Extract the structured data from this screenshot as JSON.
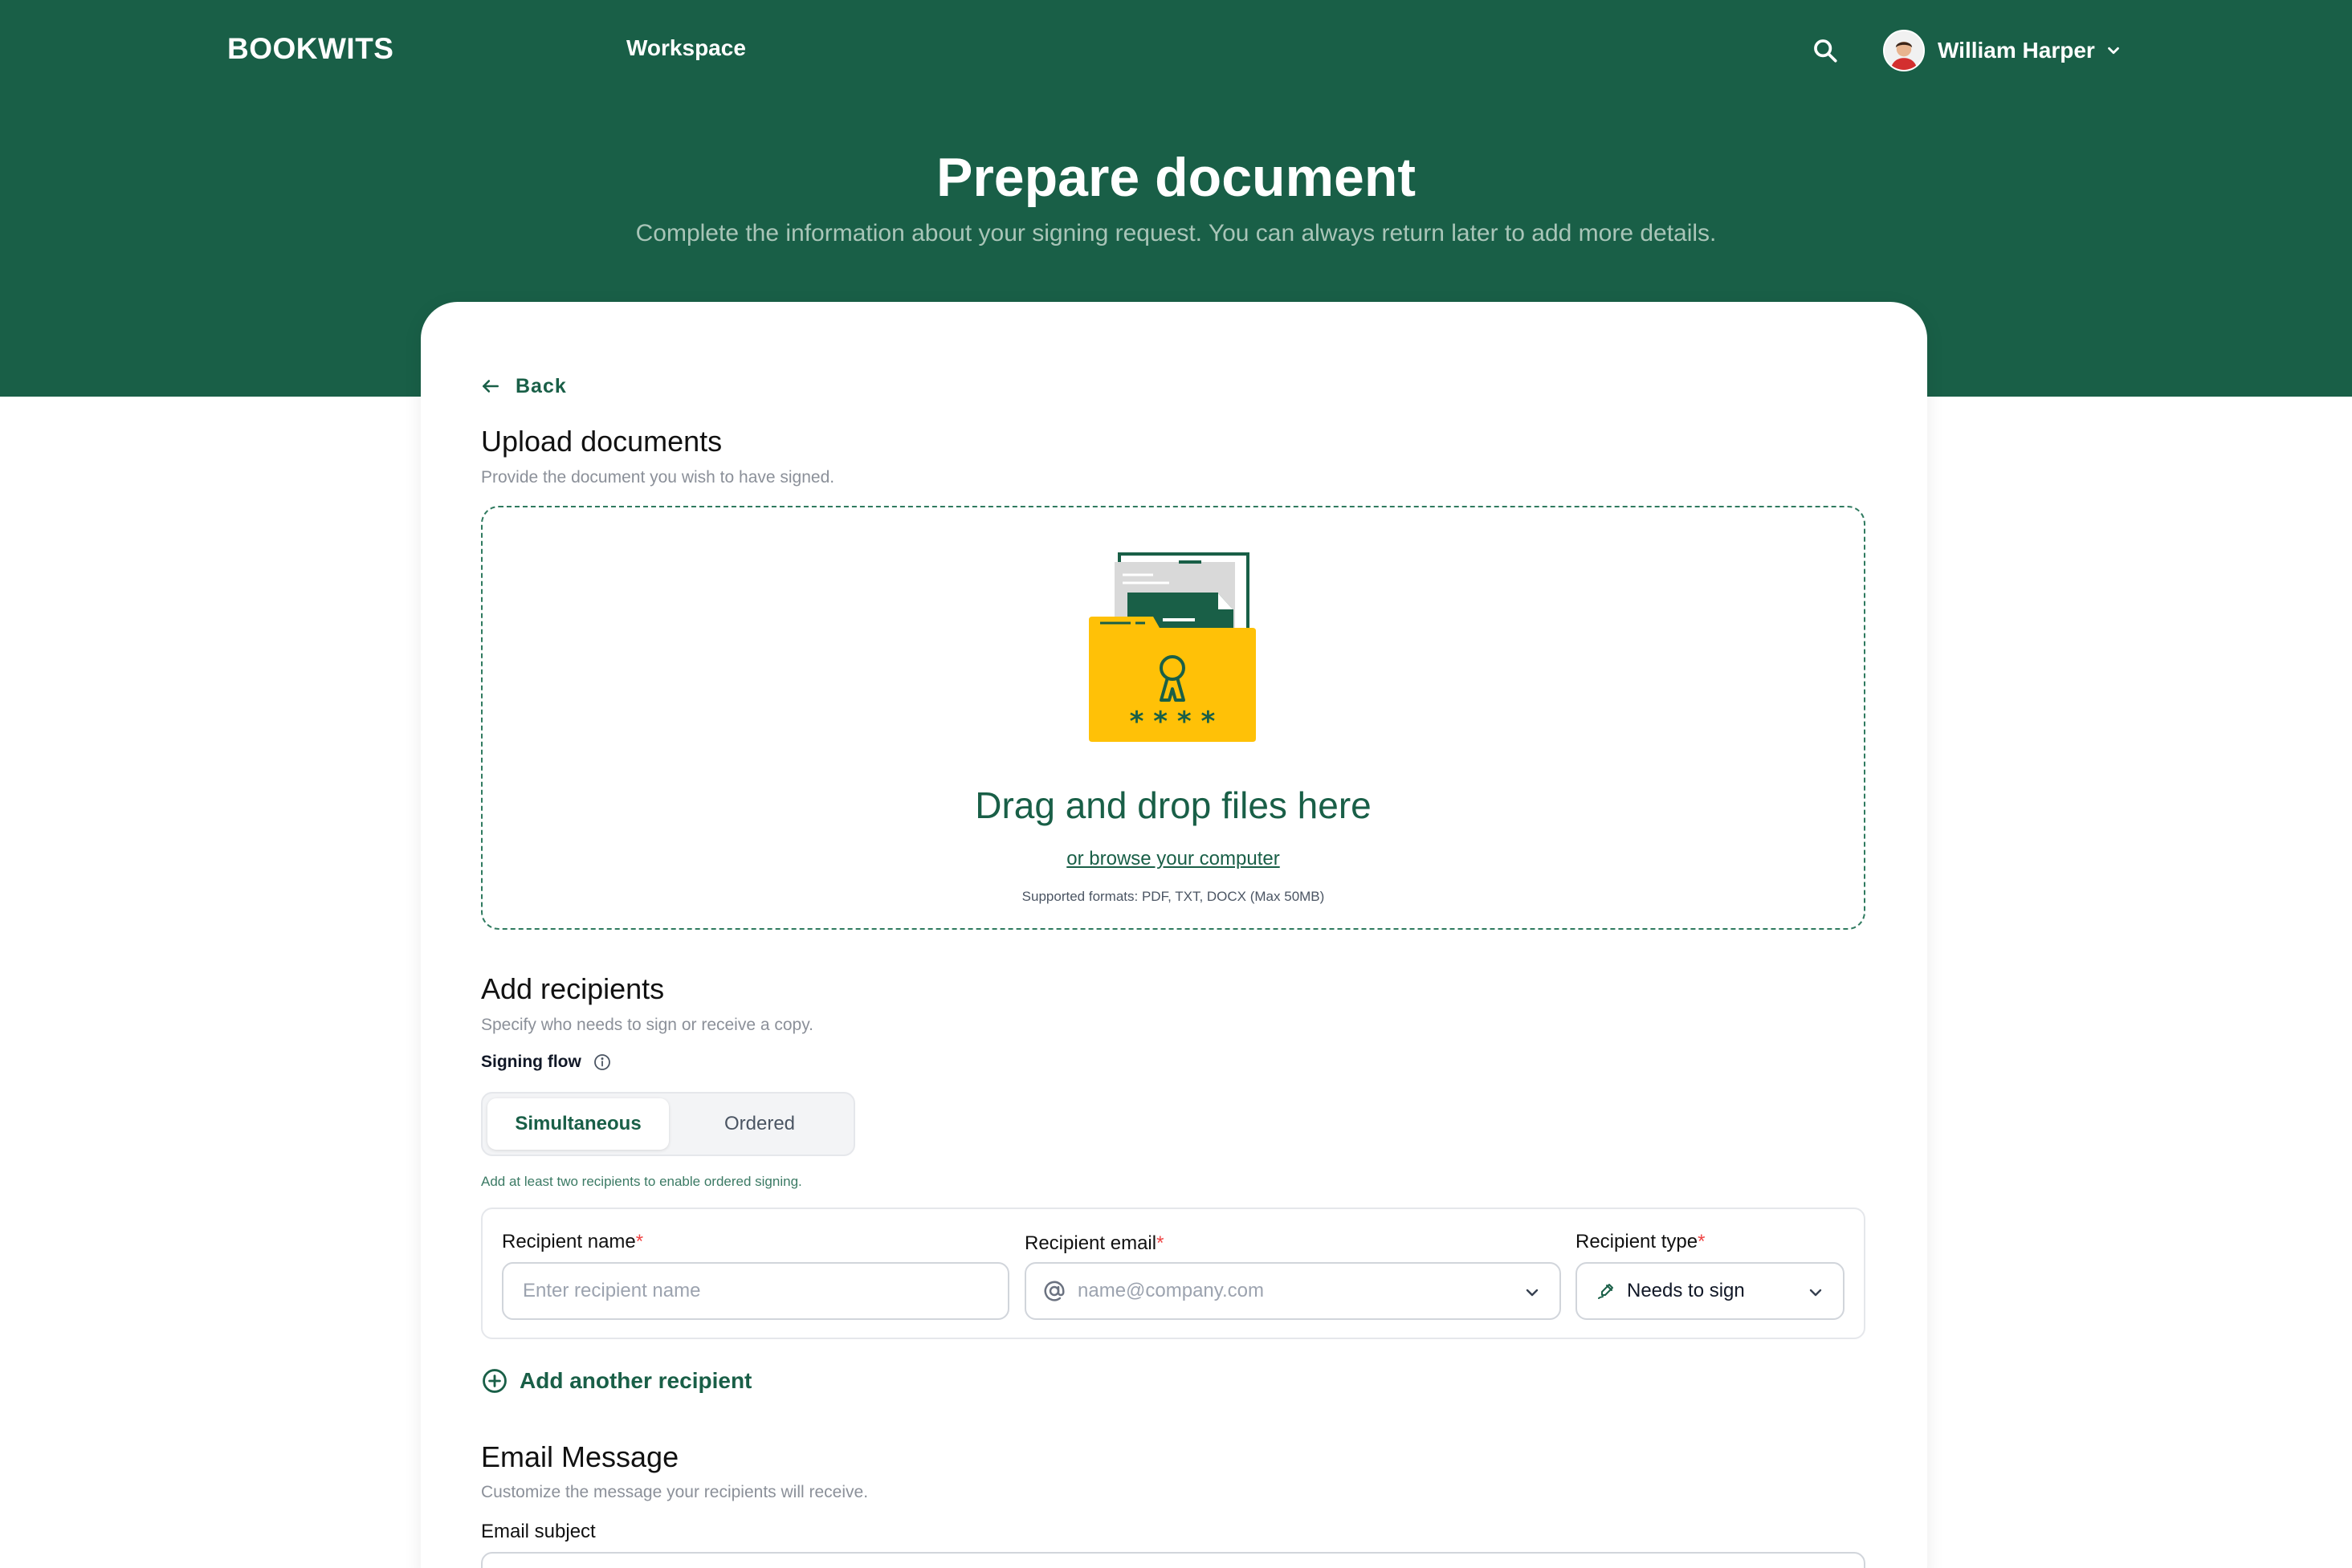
{
  "nav": {
    "logo": "BOOKWITS",
    "workspace_link": "Workspace",
    "user_name": "William Harper"
  },
  "hero": {
    "title": "Prepare document",
    "subtitle": "Complete the information about your signing request. You can always return later to add more details."
  },
  "back_label": "Back",
  "upload": {
    "title": "Upload documents",
    "subtitle": "Provide the document you wish to have signed.",
    "drop_title": "Drag and drop files here",
    "browse_link": "or browse your computer",
    "formats": "Supported formats: PDF, TXT, DOCX (Max 50MB)",
    "illustration_mask": "* * * *"
  },
  "recipients": {
    "title": "Add recipients",
    "subtitle": "Specify who needs to sign or receive a copy.",
    "signing_flow_label": "Signing flow",
    "flow_options": [
      "Simultaneous",
      "Ordered"
    ],
    "flow_selected": "Simultaneous",
    "helper": "Add at least two recipients to enable ordered signing.",
    "name_label": "Recipient name",
    "name_placeholder": "Enter recipient name",
    "email_label": "Recipient email",
    "email_placeholder": "name@company.com",
    "type_label": "Recipient type",
    "type_value": "Needs to sign",
    "required_mark": "*",
    "add_another": "Add another recipient"
  },
  "email": {
    "title": "Email Message",
    "subtitle": "Customize the message your recipients will receive.",
    "subject_label": "Email subject"
  },
  "colors": {
    "brand_green": "#195f47",
    "folder_yellow": "#ffc107",
    "required_red": "#ef4444"
  }
}
